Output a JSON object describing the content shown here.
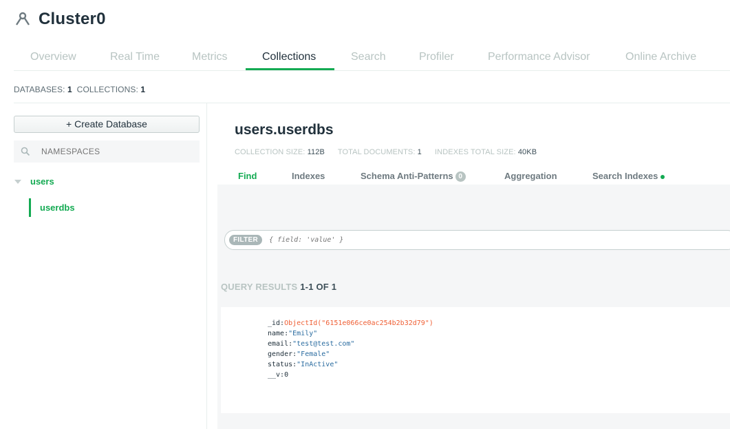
{
  "cluster": {
    "title": "Cluster0"
  },
  "tabs": [
    "Overview",
    "Real Time",
    "Metrics",
    "Collections",
    "Search",
    "Profiler",
    "Performance Advisor",
    "Online Archive"
  ],
  "active_tab": "Collections",
  "counts": {
    "databases_label": "DATABASES:",
    "databases_value": "1",
    "collections_label": "COLLECTIONS:",
    "collections_value": "1"
  },
  "sidebar": {
    "create_button": "+ Create Database",
    "search_placeholder": "NAMESPACES",
    "database": "users",
    "collection": "userdbs"
  },
  "collection": {
    "title": "users.userdbs",
    "size_label": "COLLECTION SIZE:",
    "size_value": "112B",
    "docs_label": "TOTAL DOCUMENTS:",
    "docs_value": "1",
    "index_label": "INDEXES TOTAL SIZE:",
    "index_value": "40KB"
  },
  "subtabs": {
    "find": "Find",
    "indexes": "Indexes",
    "schema": "Schema Anti-Patterns",
    "schema_badge": "0",
    "aggregation": "Aggregation",
    "search_indexes": "Search Indexes"
  },
  "filter": {
    "label": "FILTER",
    "placeholder": "{ field: 'value' }"
  },
  "results": {
    "label": "QUERY RESULTS",
    "range": "1-1 OF 1"
  },
  "document": {
    "id_key": "_id:",
    "id_value": "ObjectId(\"6151e066ce0ac254b2b32d79\")",
    "name_key": "name:",
    "name_value": "\"Emily\"",
    "email_key": "email:",
    "email_value": "\"test@test.com\"",
    "gender_key": "gender:",
    "gender_value": "\"Female\"",
    "status_key": "status:",
    "status_value": "\"InActive\"",
    "v_key": "__v:",
    "v_value": "0"
  },
  "colors": {
    "accent": "#13aa52",
    "objectid": "#ef5e33",
    "string": "#2b6ca0"
  }
}
